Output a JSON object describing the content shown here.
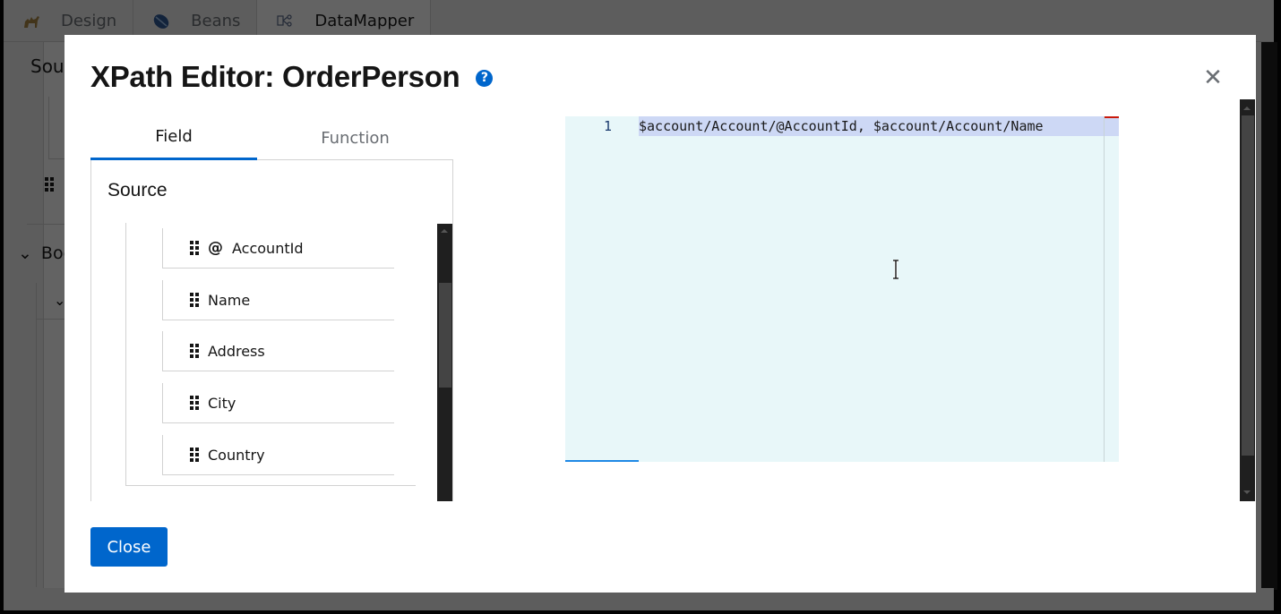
{
  "app": {
    "top_tabs": [
      {
        "label": "Design",
        "icon": "camel-icon",
        "active": false
      },
      {
        "label": "Beans",
        "icon": "bean-icon",
        "active": false
      },
      {
        "label": "DataMapper",
        "icon": "datamapper-icon",
        "active": true
      }
    ],
    "background": {
      "source_partial": "Sou",
      "body_partial": "Boc"
    }
  },
  "modal": {
    "title": "XPath Editor: OrderPerson",
    "help_icon": "help-icon",
    "close_icon": "close-icon",
    "tabs": [
      {
        "label": "Field",
        "active": true
      },
      {
        "label": "Function",
        "active": false
      }
    ],
    "source": {
      "title": "Source",
      "items": [
        {
          "label": "AccountId",
          "attribute": true
        },
        {
          "label": "Name",
          "attribute": false
        },
        {
          "label": "Address",
          "attribute": false
        },
        {
          "label": "City",
          "attribute": false
        },
        {
          "label": "Country",
          "attribute": false
        }
      ]
    },
    "editor": {
      "lines": [
        {
          "number": "1",
          "text": "$account/Account/@AccountId, $account/Account/Name"
        }
      ]
    },
    "close_button": "Close"
  },
  "colors": {
    "accent": "#0066cc",
    "editor_bg": "#e8f7f9",
    "selection": "#cdd8f5"
  }
}
